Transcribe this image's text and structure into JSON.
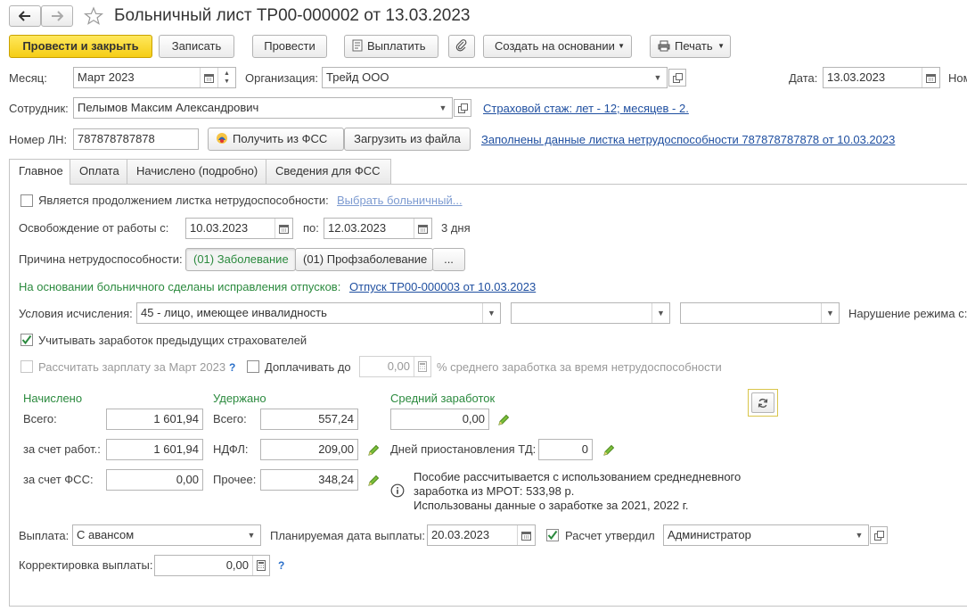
{
  "header": {
    "title": "Больничный лист ТР00-000002 от 13.03.2023"
  },
  "toolbar": {
    "post_close": "Провести и закрыть",
    "save": "Записать",
    "post": "Провести",
    "pay": "Выплатить",
    "create_based": "Создать на основании",
    "print": "Печать"
  },
  "form": {
    "month_label": "Месяц:",
    "month": "Март 2023",
    "org_label": "Организация:",
    "org": "Трейд ООО",
    "date_label": "Дата:",
    "date": "13.03.2023",
    "num_label_cut": "Ном",
    "employee_label": "Сотрудник:",
    "employee": "Пелымов Максим Александрович",
    "insurance_link": "Страховой стаж: лет - 12; месяцев - 2.",
    "ln_label": "Номер ЛН:",
    "ln": "787878787878",
    "get_fss": "Получить из ФСС",
    "load_file": "Загрузить из файла",
    "filled_link": "Заполнены данные листка нетрудоспособности 787878787878 от 10.03.2023"
  },
  "tabs": [
    "Главное",
    "Оплата",
    "Начислено (подробно)",
    "Сведения для ФСС"
  ],
  "main": {
    "continuation_label": "Является продолжением листка нетрудоспособности:",
    "choose_sick_link": "Выбрать больничный...",
    "release_label": "Освобождение от работы с:",
    "release_from": "10.03.2023",
    "to_label": "по:",
    "release_to": "12.03.2023",
    "days": "3 дня",
    "reason_label": "Причина нетрудоспособности:",
    "reason_1": "(01) Заболевание",
    "reason_2": "(01) Профзаболевание",
    "reason_more": "...",
    "vacation_note": "На основании больничного сделаны исправления отпусков:",
    "vacation_link": "Отпуск ТР00-000003 от 10.03.2023",
    "conditions_label": "Условия исчисления:",
    "conditions": "45 - лицо, имеющее инвалидность",
    "violation_label": "Нарушение режима с:",
    "prev_insurers_label": "Учитывать заработок предыдущих страхователей",
    "calc_salary_label": "Рассчитать зарплату за Март 2023",
    "help_mark": "?",
    "topup_label": "Доплачивать до",
    "topup_value": "0,00",
    "topup_suffix": "% среднего заработка за время нетрудоспособности"
  },
  "amounts": {
    "accrued_header": "Начислено",
    "withheld_header": "Удержано",
    "avg_header": "Средний заработок",
    "total_label": "Всего:",
    "accrued_total": "1 601,94",
    "employer_label": "за счет работ.:",
    "accrued_employer": "1 601,94",
    "fss_label": "за счет ФСС:",
    "accrued_fss": "0,00",
    "withheld_total_label": "Всего:",
    "withheld_total": "557,24",
    "ndfl_label": "НДФЛ:",
    "ndfl": "209,00",
    "other_label": "Прочее:",
    "other": "348,24",
    "avg_earnings": "0,00",
    "suspension_label": "Дней приостановления ТД:",
    "suspension_days": "0",
    "info_line1": "Пособие рассчитывается с использованием среднедневного",
    "info_line2": "заработка из МРОТ: 533,98 р.",
    "info_line3": "Использованы данные о заработке за  2021,  2022 г."
  },
  "payment": {
    "pay_label": "Выплата:",
    "pay_type": "С авансом",
    "planned_label": "Планируемая дата выплаты:",
    "planned_date": "20.03.2023",
    "approved_label": "Расчет утвердил",
    "approver": "Администратор",
    "correction_label": "Корректировка выплаты:",
    "correction": "0,00",
    "help_mark": "?"
  }
}
